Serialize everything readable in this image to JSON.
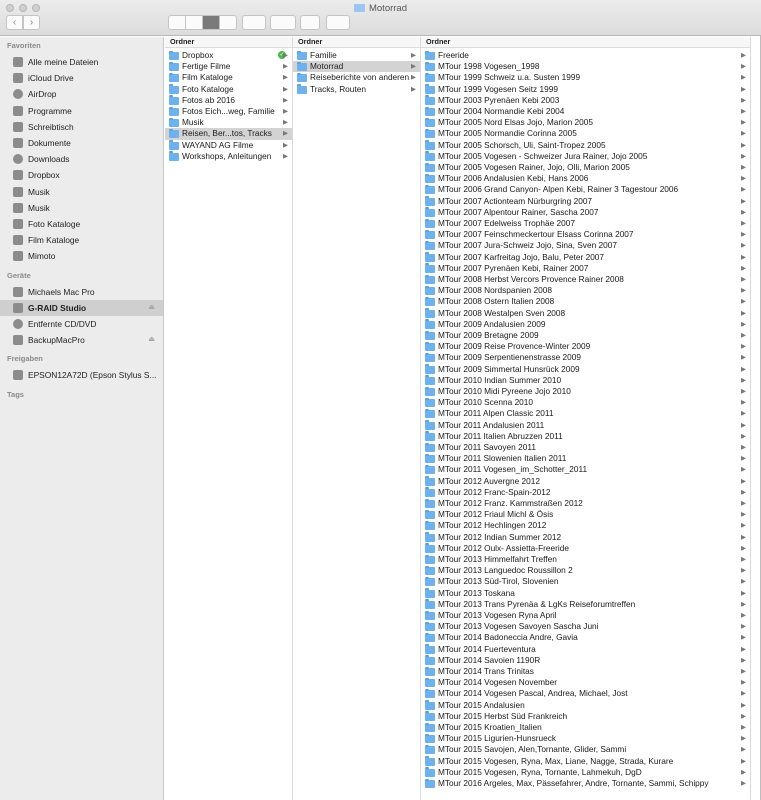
{
  "window": {
    "title": "Motorrad"
  },
  "sidebar": {
    "favorites_heading": "Favoriten",
    "favorites": [
      {
        "label": "Alle meine Dateien",
        "icon": "all-files-icon"
      },
      {
        "label": "iCloud Drive",
        "icon": "cloud-icon"
      },
      {
        "label": "AirDrop",
        "icon": "airdrop-icon"
      },
      {
        "label": "Programme",
        "icon": "applications-icon"
      },
      {
        "label": "Schreibtisch",
        "icon": "desktop-icon"
      },
      {
        "label": "Dokumente",
        "icon": "document-icon"
      },
      {
        "label": "Downloads",
        "icon": "download-icon"
      },
      {
        "label": "Dropbox",
        "icon": "dropbox-icon"
      },
      {
        "label": "Musik",
        "icon": "folder-icon"
      },
      {
        "label": "Musik",
        "icon": "music-icon"
      },
      {
        "label": "Foto Kataloge",
        "icon": "folder-icon"
      },
      {
        "label": "Film Kataloge",
        "icon": "folder-icon"
      },
      {
        "label": "Mimoto",
        "icon": "folder-icon"
      }
    ],
    "devices_heading": "Geräte",
    "devices": [
      {
        "label": "Michaels Mac Pro",
        "icon": "computer-icon"
      },
      {
        "label": "G-RAID Studio",
        "icon": "drive-icon",
        "selected": true
      },
      {
        "label": "Entfernte CD/DVD",
        "icon": "disc-icon"
      },
      {
        "label": "BackupMacPro",
        "icon": "drive-icon"
      }
    ],
    "shared_heading": "Freigaben",
    "shared": [
      {
        "label": "EPSON12A72D (Epson Stylus S...",
        "icon": "printer-icon"
      }
    ],
    "tags_heading": "Tags"
  },
  "column1": {
    "header": "Ordner",
    "items": [
      {
        "label": "Dropbox",
        "synced": true
      },
      {
        "label": "Fertige Filme"
      },
      {
        "label": "Film Kataloge"
      },
      {
        "label": "Foto Kataloge"
      },
      {
        "label": "Fotos ab 2016"
      },
      {
        "label": "Fotos Eich...weg, Familie"
      },
      {
        "label": "Musik"
      },
      {
        "label": "Reisen, Ber...tos, Tracks",
        "selected": true
      },
      {
        "label": "WAYAND AG  Filme"
      },
      {
        "label": "Workshops, Anleitungen"
      }
    ]
  },
  "column2": {
    "header": "Ordner",
    "items": [
      {
        "label": "Familie"
      },
      {
        "label": "Motorrad",
        "selected": true
      },
      {
        "label": "Reiseberichte von anderen"
      },
      {
        "label": "Tracks, Routen"
      }
    ]
  },
  "column3": {
    "header": "Ordner",
    "items": [
      "Freeride",
      "MTour 1998 Vogesen_1998",
      "MTour 1999 Schweiz u.a. Susten 1999",
      "MTour 1999 Vogesen Seitz 1999",
      "MTour 2003 Pyrenäen Kebi 2003",
      "MTour 2004 Normandie Kebi 2004",
      "MTour 2005 Nord Elsas Jojo, Marion 2005",
      "MTour 2005 Normandie Corinna 2005",
      "MTour 2005 Schorsch, Uli, Saint-Tropez 2005",
      "MTour 2005 Vogesen - Schweizer Jura Rainer, Jojo 2005",
      "MTour 2005 Vogesen Rainer, Jojo, Olli, Marion 2005",
      "MTour 2006 Andalusien Kebi, Hans 2006",
      "MTour 2006 Grand Canyon- Alpen Kebi, Rainer 3 Tagestour 2006",
      "MTour 2007 Actionteam Nürburgring 2007",
      "MTour 2007 Alpentour Rainer, Sascha 2007",
      "MTour 2007 Edelweiss Trophäe 2007",
      "MTour 2007 Feinschmeckertour Elsass Corinna  2007",
      "MTour 2007 Jura-Schweiz Jojo, Sina, Sven 2007",
      "MTour 2007 Karfreitag Jojo, Balu, Peter 2007",
      "MTour 2007 Pyrenäen Kebi, Rainer 2007",
      "MTour 2008 Herbst Vercors Provence Rainer 2008",
      "MTour 2008 Nordspanien 2008",
      "MTour 2008 Ostern Italien 2008",
      "MTour 2008 Westalpen Sven 2008",
      "MTour 2009 Andalusien 2009",
      "MTour 2009 Bretagne 2009",
      "MTour 2009 Reise Provence-Winter 2009",
      "MTour 2009 Serpentienenstrasse 2009",
      "MTour 2009 Simmertal Hunsrück 2009",
      "MTour 2010 Indian Summer 2010",
      "MTour 2010 Midi Pyreene Jojo 2010",
      "MTour 2010 Scenna 2010",
      "MTour 2011 Alpen Classic 2011",
      "MTour 2011 Andalusien 2011",
      "MTour 2011 Italien Abruzzen 2011",
      "MTour 2011 Savoyen 2011",
      "MTour 2011 Slowenien Italien 2011",
      "MTour 2011 Vogesen_im_Schotter_2011",
      "MTour 2012 Auvergne 2012",
      "MTour 2012 Franc-Spain-2012",
      "MTour 2012 Franz. Kammstraßen 2012",
      "MTour 2012 Friaul Michl & Ösis",
      "MTour 2012 Hechlingen 2012",
      "MTour 2012 Indian Summer 2012",
      "MTour 2012 Oulx- Assietta-Freeride",
      "MTour 2013 Himmelfahrt Treffen",
      "MTour 2013 Languedoc Roussillon 2",
      "MTour 2013 Süd-Tirol, Slovenien",
      "MTour 2013 Toskana",
      "MTour 2013 Trans Pyrenäa & LgKs Reiseforumtreffen",
      "MTour 2013 Vogesen Ryna April",
      "MTour 2013 Vogesen Savoyen Sascha Juni",
      "MTour 2014 Badoneccia Andre, Gavia",
      "MTour 2014 Fuerteventura",
      "MTour 2014 Savoien 1190R",
      "MTour 2014 Trans Trinitas",
      "MTour 2014 Vogesen November",
      "MTour 2014 Vogesen Pascal, Andrea, Michael, Jost",
      "MTour 2015 Andalusien",
      "MTour 2015 Herbst Süd Frankreich",
      "MTour 2015 Kroatien_Italien",
      "MTour 2015 Ligurien-Hunsrueck",
      "MTour 2015 Savojen, Alen,Tornante, Glider, Sammi",
      "MTour 2015 Vogesen, Ryna, Max, Liane, Nagge, Strada, Kurare",
      "MTour 2015 Vogesen, Ryna, Tornante, Lahmekuh, DgD",
      "MTour 2016 Argeles, Max, Pässefahrer, Andre, Tornante, Sammi, Schippy"
    ]
  },
  "colors": {
    "folder": "#6db2ec",
    "selection": "#d3d3d3",
    "sidebar_bg": "#ececec"
  }
}
